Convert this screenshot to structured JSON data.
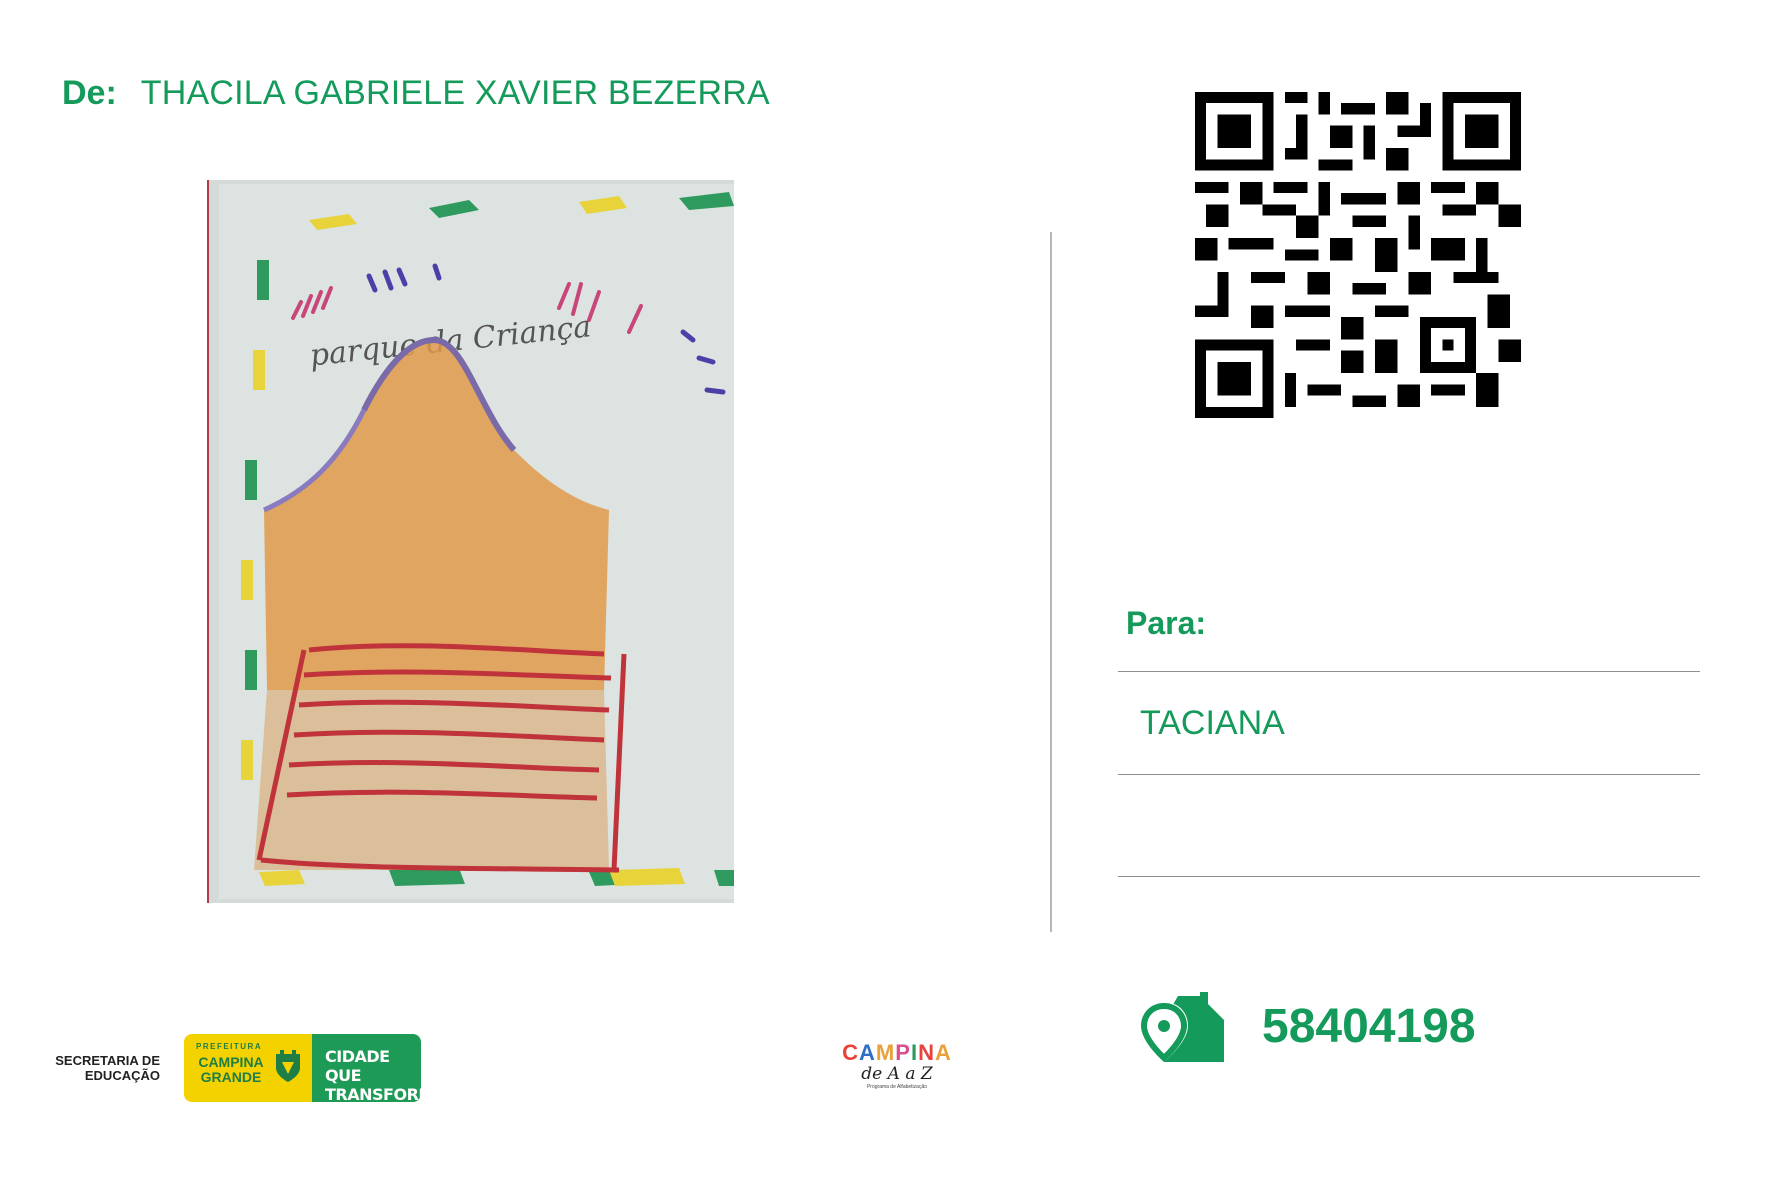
{
  "sender": {
    "label": "De:",
    "name": "THACILA GABRIELE XAVIER BEZERRA"
  },
  "drawing": {
    "title_text": "parque da Criança"
  },
  "recipient": {
    "label": "Para:",
    "name": "TACIANA"
  },
  "postal_code": {
    "value": "58404198",
    "icon": "map-pin-house-icon"
  },
  "footer": {
    "secretaria": "SECRETARIA DE EDUCAÇÃO",
    "prefeitura_small": "PREFEITURA",
    "prefeitura_name": "CAMPINA GRANDE",
    "slogan": "CIDADE QUE TRANSFORMA",
    "program_title": "CAMPINA",
    "program_subtitle": "de A a Z",
    "program_tagline": "Programa de Alfabetização"
  },
  "colors": {
    "brand_green": "#149a5a",
    "yellow": "#f4d200"
  }
}
